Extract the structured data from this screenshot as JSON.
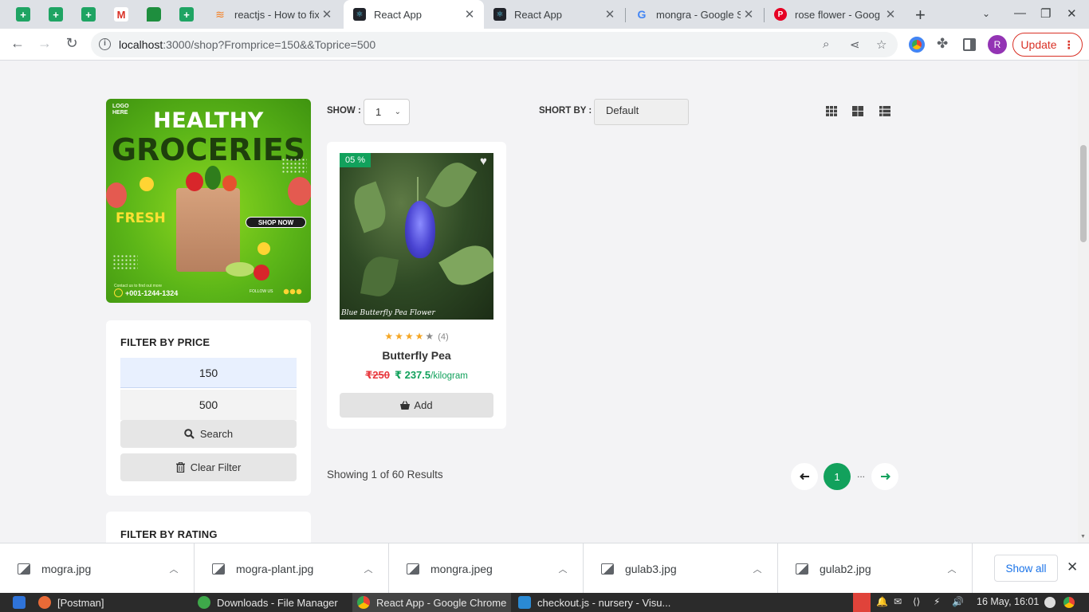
{
  "browser": {
    "tabs": [
      {
        "title": "reactjs - How to fix",
        "favicon": "stackoverflow-icon",
        "active": false
      },
      {
        "title": "React App",
        "favicon": "react-icon",
        "active": true
      },
      {
        "title": "React App",
        "favicon": "react-icon",
        "active": false
      },
      {
        "title": "mongra - Google S",
        "favicon": "google-icon",
        "active": false
      },
      {
        "title": "rose flower - Goog",
        "favicon": "pinterest-icon",
        "active": false
      }
    ],
    "url_host": "localhost",
    "url_rest": ":3000/shop?Fromprice=150&&Toprice=500",
    "profile_initial": "R",
    "update_label": "Update"
  },
  "banner": {
    "logo": "LOGO HERE",
    "headline1": "HEALTHY",
    "headline2": "GROCERIES",
    "fresh": "FRESH",
    "shop_now": "SHOP NOW",
    "contact": "Contact us to find out more",
    "phone": "+001-1244-1324",
    "follow": "FOLLOW US"
  },
  "filter_price": {
    "title": "FILTER BY PRICE",
    "from": "150",
    "to": "500",
    "search_label": "Search",
    "clear_label": "Clear Filter"
  },
  "filter_rating": {
    "title": "FILTER BY RATING"
  },
  "shop_toolbar": {
    "show_label": "SHOW :",
    "show_value": "1",
    "sort_label": "SHORT BY :",
    "sort_value": "Default"
  },
  "product": {
    "discount": "05 %",
    "image_caption": "Blue Butterfly Pea Flower",
    "rating_stars": 4,
    "rating_count": "(4)",
    "name": "Butterfly Pea",
    "old_price": "₹250",
    "new_price": "₹ 237.5",
    "unit": "/kilogram",
    "add_label": "Add"
  },
  "results_text": "Showing 1 of 60 Results",
  "pagination": {
    "current": "1",
    "ellipsis": "..."
  },
  "downloads": {
    "items": [
      "mogra.jpg",
      "mogra-plant.jpg",
      "mongra.jpeg",
      "gulab3.jpg",
      "gulab2.jpg"
    ],
    "show_all": "Show all"
  },
  "taskbar": {
    "tasks": [
      "[Postman]",
      "Downloads - File Manager",
      "React App - Google Chrome",
      "checkout.js - nursery - Visu..."
    ],
    "clock": "16 May, 16:01"
  },
  "colors": {
    "accent_green": "#12a15c",
    "old_price_red": "#e8383d",
    "update_red": "#d93025",
    "link_blue": "#1a73e8"
  }
}
